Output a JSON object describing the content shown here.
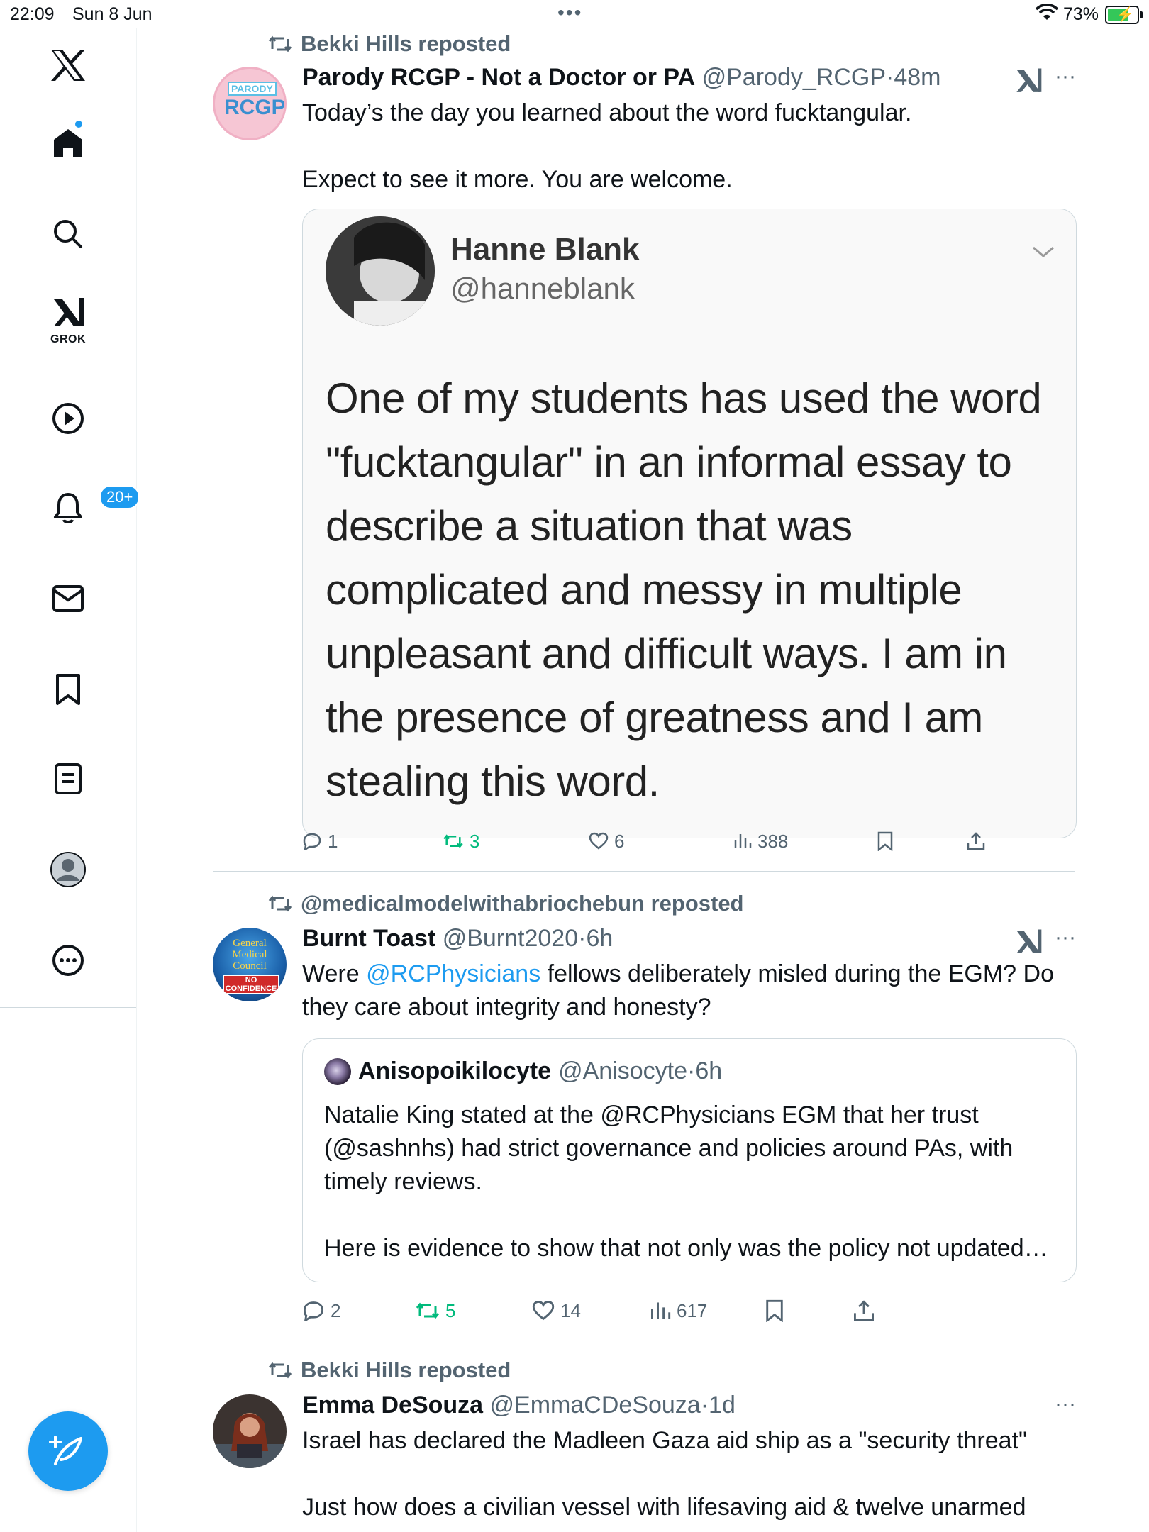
{
  "status_bar": {
    "time": "22:09",
    "date": "Sun 8 Jun",
    "battery_pct": "73%",
    "battery_level": 0.73,
    "charging": true
  },
  "sidebar": {
    "items": [
      {
        "icon": "x-logo-icon"
      },
      {
        "icon": "home-icon",
        "has_dot": true
      },
      {
        "icon": "search-icon"
      },
      {
        "icon": "grok-icon",
        "label": "GROK"
      },
      {
        "icon": "video-play-icon"
      },
      {
        "icon": "notifications-bell-icon",
        "badge": "20+"
      },
      {
        "icon": "messages-mail-icon"
      },
      {
        "icon": "bookmark-icon"
      },
      {
        "icon": "lists-icon"
      },
      {
        "icon": "profile-avatar-icon"
      },
      {
        "icon": "more-circle-icon"
      }
    ],
    "compose_icon": "compose-feather-icon"
  },
  "colors": {
    "accent": "#1d9bf0",
    "repost_green": "#00ba7c",
    "secondary_text": "#536471",
    "divider": "#cfd9de"
  },
  "tweets": [
    {
      "reposted_by": "Bekki Hills reposted",
      "name": "Parody RCGP - Not a Doctor or PA",
      "handle": "@Parody_RCGP",
      "sep": "·",
      "time": "48m",
      "text": "Today’s the day you learned about the word fucktangular.\n\nExpect to see it more. You are welcome.",
      "avatar_text_top": "PARODY",
      "avatar_text_main": "RCGP",
      "image_quote": {
        "name": "Hanne Blank",
        "handle": "@hanneblank",
        "body": "One of my students has used the word \"fucktangular\" in an informal essay to describe a situation that was complicated and messy in multiple unpleasant and difficult ways.  I am in the presence of greatness and I am stealing this word."
      },
      "stats": {
        "replies": "1",
        "reposts": "3",
        "likes": "6",
        "views": "388"
      }
    },
    {
      "reposted_by": "@medicalmodelwithabriochebun reposted",
      "name": "Burnt Toast",
      "handle": "@Burnt2020",
      "sep": "·",
      "time": "6h",
      "text_before": "Were ",
      "text_mention": "@RCPhysicians",
      "text_after": " fellows deliberately misled during the EGM? Do they care about integrity and honesty?",
      "avatar_text": "General Medical Council",
      "avatar_subtext": "NO CONFIDENCE",
      "quote": {
        "name": "Anisopoikilocyte",
        "handle": "@Anisocyte",
        "sep": "·",
        "time": "6h",
        "text": "Natalie King stated at the @RCPhysicians EGM that her trust (@sashnhs) had strict governance and policies around PAs, with timely reviews.\n\nHere is evidence to show that not only was the policy not updated…"
      },
      "stats": {
        "replies": "2",
        "reposts": "5",
        "likes": "14",
        "views": "617"
      }
    },
    {
      "reposted_by": "Bekki Hills reposted",
      "name": "Emma DeSouza",
      "handle": "@EmmaCDeSouza",
      "sep": "·",
      "time": "1d",
      "text": "Israel has declared the Madleen Gaza aid ship as a \"security threat\"\n\nJust how does a civilian vessel with lifesaving aid & twelve unarmed"
    }
  ]
}
